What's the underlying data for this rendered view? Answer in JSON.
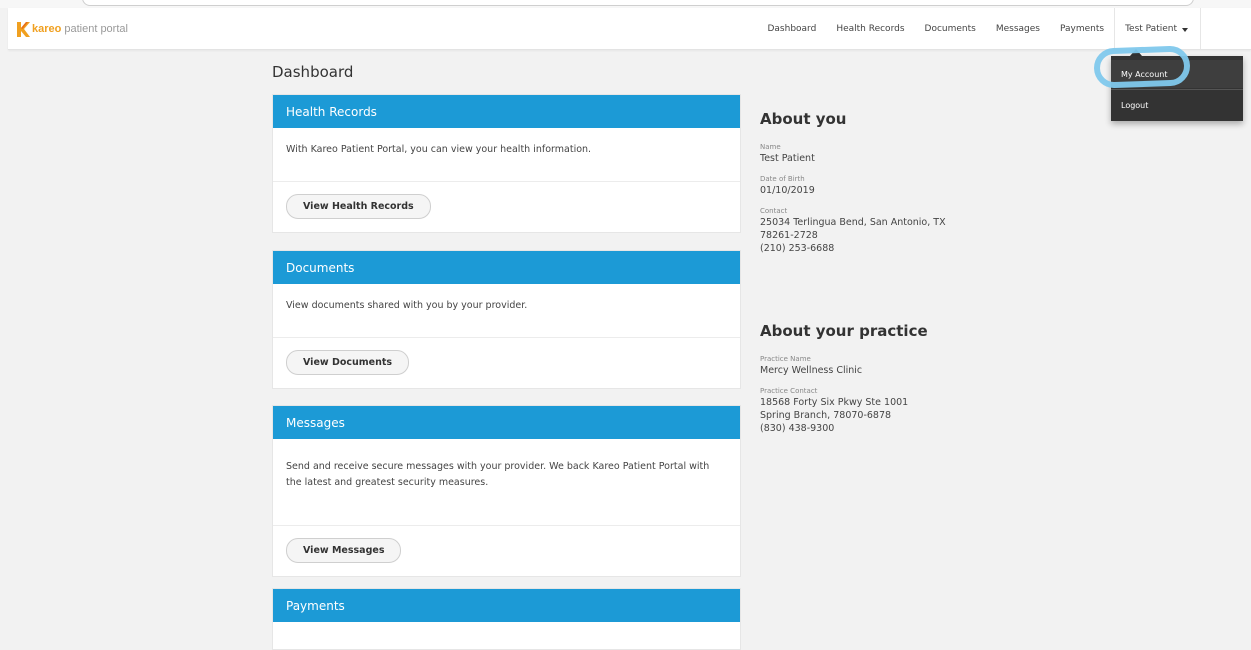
{
  "brand": {
    "name": "kareo",
    "subtitle": "patient portal",
    "accent_color": "#f0a020"
  },
  "nav": {
    "items": [
      "Dashboard",
      "Health Records",
      "Documents",
      "Messages",
      "Payments"
    ],
    "user_name": "Test Patient",
    "caret_icon": "caret-down-icon"
  },
  "user_menu": {
    "items": [
      "My Account",
      "Logout"
    ],
    "highlighted": "My Account",
    "highlight_color": "#7fc8ec"
  },
  "page": {
    "title": "Dashboard"
  },
  "cards": [
    {
      "header": "Health Records",
      "body": "With Kareo Patient Portal, you can view your health information.",
      "button": "View Health Records"
    },
    {
      "header": "Documents",
      "body": "View documents shared with you by your provider.",
      "button": "View Documents"
    },
    {
      "header": "Messages",
      "body": "Send and receive secure messages with your provider. We back Kareo Patient Portal with the latest and greatest security measures.",
      "button": "View Messages"
    },
    {
      "header": "Payments"
    }
  ],
  "card_header_color": "#1c9ad6",
  "about_you": {
    "heading": "About you",
    "name_label": "Name",
    "name": "Test Patient",
    "dob_label": "Date of Birth",
    "dob": "01/10/2019",
    "contact_label": "Contact",
    "address_line1": "25034 Terlingua Bend, San Antonio, TX",
    "address_line2": "78261-2728",
    "phone": "(210) 253-6688"
  },
  "about_practice": {
    "heading": "About your practice",
    "practice_name_label": "Practice Name",
    "practice_name": "Mercy Wellness Clinic",
    "practice_contact_label": "Practice Contact",
    "address_line1": "18568 Forty Six Pkwy Ste 1001",
    "address_line2": "Spring Branch, 78070-6878",
    "phone": "(830) 438-9300"
  }
}
